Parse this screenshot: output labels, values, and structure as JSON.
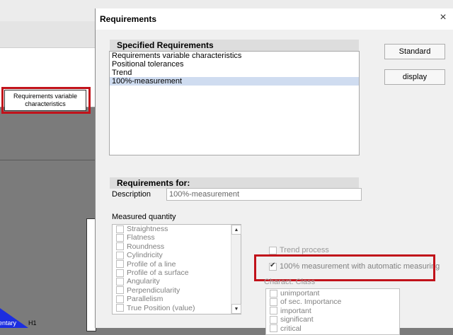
{
  "background": {
    "req_box_text": "Requirements variable characteristics",
    "complementary_label": "entary",
    "h1_label": "H1"
  },
  "dialog": {
    "title": "Requirements",
    "close_glyph": "×",
    "specified": {
      "header": "Specified Requirements",
      "items": [
        "Requirements variable characteristics",
        "Positional tolerances",
        "Trend",
        "100%-measurement"
      ],
      "selected_index": 3
    },
    "buttons": {
      "standard": "Standard",
      "display": "display"
    },
    "requirements_for": {
      "header": "Requirements for:",
      "description_label": "Description",
      "description_value": "100%-measurement",
      "measured_quantity_label": "Measured quantity",
      "measured_quantity_items": [
        "Straightness",
        "Flatness",
        "Roundness",
        "Cylindricity",
        "Profile of a line",
        "Profile of a surface",
        "Angularity",
        "Perpendicularity",
        "Parallelism",
        "True Position (value)"
      ],
      "trend_process_label": "Trend process",
      "trend_process_checked": false,
      "measurement_label": "100% measurement with automatic measuring",
      "measurement_checked": true,
      "charact_class_label": "Charact. Class",
      "charact_class_items": [
        "unimportant",
        "of sec. Importance",
        "important",
        "significant",
        "critical"
      ]
    }
  },
  "colors": {
    "highlight_red": "#c1121a",
    "selection_blue": "#cfdcf0",
    "accent_blue": "#1c2ee0"
  }
}
